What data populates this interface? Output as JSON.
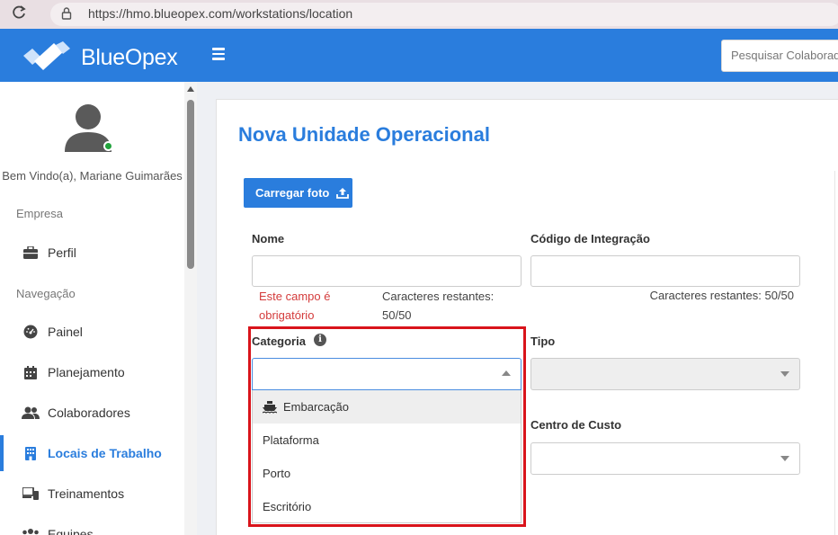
{
  "browser": {
    "url": "https://hmo.blueopex.com/workstations/location"
  },
  "header": {
    "brand": "BlueOpex",
    "search_placeholder": "Pesquisar Colaboradores"
  },
  "sidebar": {
    "welcome": "Bem Vindo(a), Mariane Guimarães",
    "section_company": "Empresa",
    "section_nav": "Navegação",
    "items": [
      {
        "label": "Perfil",
        "icon": "briefcase-icon"
      },
      {
        "label": "Painel",
        "icon": "dashboard-icon"
      },
      {
        "label": "Planejamento",
        "icon": "calendar-icon"
      },
      {
        "label": "Colaboradores",
        "icon": "users-icon"
      },
      {
        "label": "Locais de Trabalho",
        "icon": "building-icon",
        "active": true
      },
      {
        "label": "Treinamentos",
        "icon": "laptop-icon"
      },
      {
        "label": "Equipes",
        "icon": "team-icon"
      }
    ]
  },
  "form": {
    "title": "Nova Unidade Operacional",
    "upload_label": "Carregar foto",
    "name_label": "Nome",
    "name_value": "",
    "name_error": "Este campo é obrigatório",
    "name_remaining": "Caracteres restantes: 50/50",
    "code_label": "Código de Integração",
    "code_value": "",
    "code_remaining": "Caracteres restantes: 50/50",
    "category_label": "Categoria",
    "category_value": "",
    "category_options": [
      "Embarcação",
      "Plataforma",
      "Porto",
      "Escritório"
    ],
    "type_label": "Tipo",
    "cost_center_label": "Centro de Custo"
  },
  "colors": {
    "primary": "#2a7ddd",
    "error": "#d43b3b",
    "highlight_border": "#d9141b",
    "online": "#22a33c"
  }
}
